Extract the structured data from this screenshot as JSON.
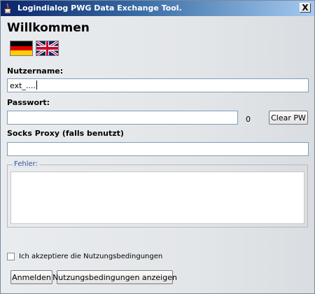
{
  "window": {
    "title": "Logindialog PWG Data Exchange Tool.",
    "close_label": "X"
  },
  "heading": "Willkommen",
  "languages": [
    {
      "name": "german-flag-icon"
    },
    {
      "name": "uk-flag-icon"
    }
  ],
  "username": {
    "label": "Nutzername:",
    "value": "ext_...."
  },
  "password": {
    "label": "Passwort:",
    "value": "",
    "count": "0",
    "clear_label": "Clear PW"
  },
  "proxy": {
    "label": "Socks Proxy (falls benutzt)",
    "value": ""
  },
  "errors": {
    "legend": "Fehler:",
    "text": ""
  },
  "terms": {
    "checkbox_label": "Ich akzeptiere die Nutzungsbedingungen",
    "checked": false
  },
  "buttons": {
    "login_label": "Anmelden",
    "show_terms_label": "Nutzungsbedingungen anzeigen"
  },
  "colors": {
    "title_gradient_start": "#0b246a",
    "title_gradient_end": "#a6caf0",
    "legend_color": "#3a54a0"
  }
}
